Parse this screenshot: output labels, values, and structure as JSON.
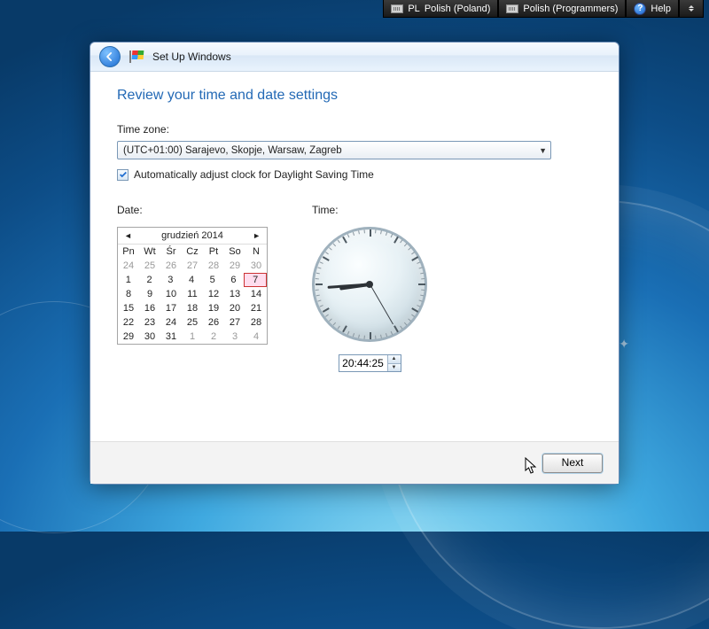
{
  "toolbar": {
    "lang_code": "PL",
    "lang_name": "Polish (Poland)",
    "keyboard_layout": "Polish (Programmers)",
    "help_label": "Help"
  },
  "window": {
    "title": "Set Up Windows",
    "heading": "Review your time and date settings",
    "timezone_label": "Time zone:",
    "timezone_value": "(UTC+01:00) Sarajevo, Skopje, Warsaw, Zagreb",
    "dst_checked": true,
    "dst_label": "Automatically adjust clock for Daylight Saving Time",
    "date_label": "Date:",
    "time_label": "Time:",
    "next_label": "Next"
  },
  "calendar": {
    "month_title": "grudzień 2014",
    "weekdays": [
      "Pn",
      "Wt",
      "Śr",
      "Cz",
      "Pt",
      "So",
      "N"
    ],
    "rows": [
      [
        {
          "d": "24",
          "o": true
        },
        {
          "d": "25",
          "o": true
        },
        {
          "d": "26",
          "o": true
        },
        {
          "d": "27",
          "o": true
        },
        {
          "d": "28",
          "o": true
        },
        {
          "d": "29",
          "o": true
        },
        {
          "d": "30",
          "o": true
        }
      ],
      [
        {
          "d": "1"
        },
        {
          "d": "2"
        },
        {
          "d": "3"
        },
        {
          "d": "4"
        },
        {
          "d": "5"
        },
        {
          "d": "6"
        },
        {
          "d": "7",
          "today": true
        }
      ],
      [
        {
          "d": "8"
        },
        {
          "d": "9"
        },
        {
          "d": "10"
        },
        {
          "d": "11"
        },
        {
          "d": "12"
        },
        {
          "d": "13"
        },
        {
          "d": "14"
        }
      ],
      [
        {
          "d": "15"
        },
        {
          "d": "16"
        },
        {
          "d": "17"
        },
        {
          "d": "18"
        },
        {
          "d": "19"
        },
        {
          "d": "20"
        },
        {
          "d": "21"
        }
      ],
      [
        {
          "d": "22"
        },
        {
          "d": "23"
        },
        {
          "d": "24"
        },
        {
          "d": "25"
        },
        {
          "d": "26"
        },
        {
          "d": "27"
        },
        {
          "d": "28"
        }
      ],
      [
        {
          "d": "29"
        },
        {
          "d": "30"
        },
        {
          "d": "31"
        },
        {
          "d": "1",
          "o": true
        },
        {
          "d": "2",
          "o": true
        },
        {
          "d": "3",
          "o": true
        },
        {
          "d": "4",
          "o": true
        }
      ]
    ]
  },
  "time": {
    "display": "20:44:25",
    "hour_angle": 262,
    "minute_angle": 266,
    "second_angle": 150
  }
}
